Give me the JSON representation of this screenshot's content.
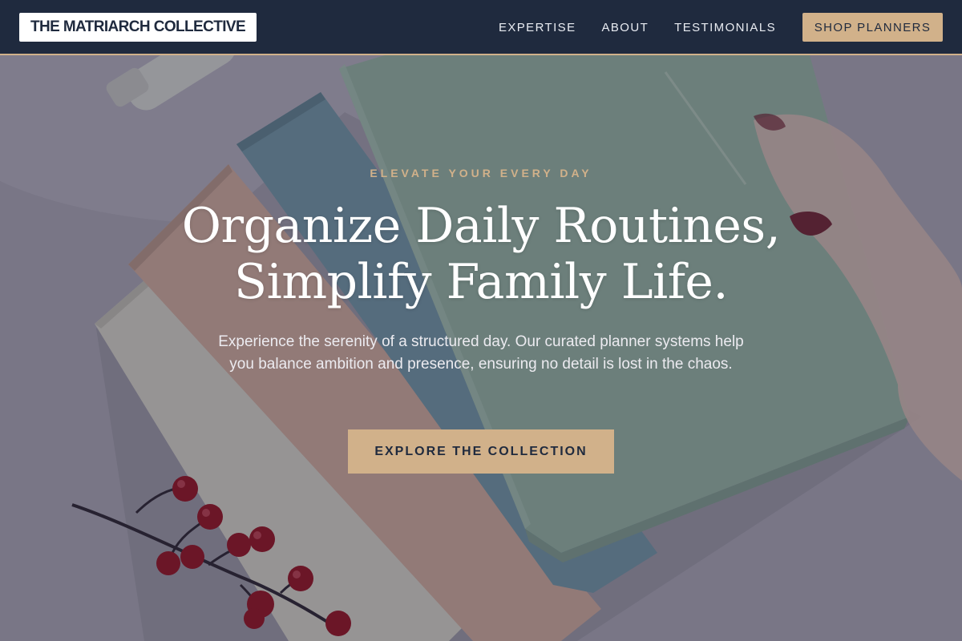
{
  "nav": {
    "logo": "THE MATRIARCH COLLECTIVE",
    "links": [
      "EXPERTISE",
      "ABOUT",
      "TESTIMONIALS"
    ],
    "cta_label": "SHOP PLANNERS"
  },
  "hero": {
    "eyebrow": "ELEVATE YOUR EVERY DAY",
    "headline_line1": "Organize Daily Routines,",
    "headline_line2": "Simplify Family Life.",
    "subtext": "Experience the serenity of a structured day. Our curated planner systems help you balance ambition and presence, ensuring no detail is lost in the chaos.",
    "cta_label": "EXPLORE THE COLLECTION"
  },
  "colors": {
    "navy": "#1f2a3e",
    "gold": "#d1b18a",
    "text_light": "#ffffff"
  }
}
